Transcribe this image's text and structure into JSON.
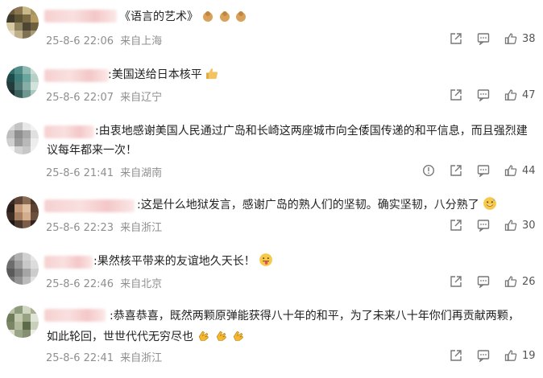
{
  "comments": [
    {
      "prefix": "",
      "text": "《语言的艺术》",
      "date": "25-8-6 22:06",
      "location": "来自上海",
      "likes": "38",
      "emojis": [
        "clapping-hands",
        "clapping-hands",
        "clapping-hands"
      ],
      "report": false
    },
    {
      "prefix": ":",
      "text": "美国送给日本核平",
      "date": "25-8-6 22:07",
      "location": "来自辽宁",
      "likes": "47",
      "emojis": [
        "thumbs-up"
      ],
      "report": false
    },
    {
      "prefix": ":",
      "text": "由衷地感谢美国人民通过广岛和长崎这两座城市向全倭国传递的和平信息，而且强烈建",
      "text2": "议每年都来一次！",
      "date": "25-8-6 21:41",
      "location": "来自湖南",
      "likes": "44",
      "emojis": [],
      "report": true
    },
    {
      "prefix": ":",
      "text": "这是什么地狱发言，感谢广岛的熟人们的坚韧。确实坚韧，八分熟了",
      "date": "25-8-6 22:23",
      "location": "来自浙江",
      "likes": "30",
      "emojis": [
        "sweat-smile"
      ],
      "report": false
    },
    {
      "prefix": ":",
      "text": "果然核平带来的友谊地久天长！",
      "date": "25-8-6 22:46",
      "location": "来自北京",
      "likes": "26",
      "emojis": [
        "tongue-out"
      ],
      "report": false
    },
    {
      "prefix": ":",
      "text": "恭喜恭喜，既然两颗原弹能获得八十年的和平，为了未来八十年你们再贡献两颗，",
      "text2": "如此轮回，世世代代无穷尽也",
      "date": "25-8-6 22:41",
      "location": "来自浙江",
      "likes": "19",
      "emojis": [
        "clap",
        "clap",
        "clap"
      ],
      "report": false
    }
  ],
  "icons": {
    "share": "share-icon",
    "comment": "comment-icon",
    "like": "thumbs-up-icon",
    "report": "report-icon"
  }
}
